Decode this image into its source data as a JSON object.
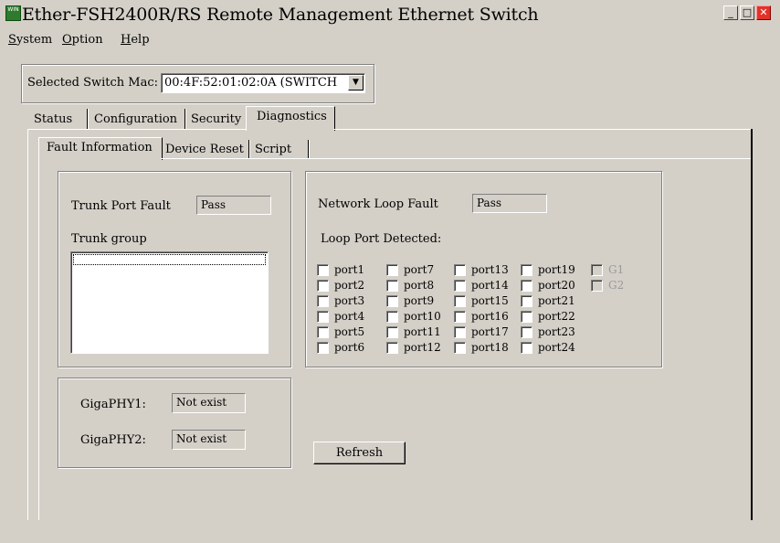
{
  "window": {
    "title": "Ether-FSH2400R/RS Remote Management Ethernet Switch",
    "icon_text": "WIN",
    "minimize": "_",
    "maximize": "□",
    "close": "✕"
  },
  "menu": {
    "items": [
      {
        "label": "System",
        "mnemonic": "S",
        "rest": "ystem"
      },
      {
        "label": "Option",
        "mnemonic": "O",
        "rest": "ption"
      },
      {
        "label": "Help",
        "mnemonic": "H",
        "rest": "elp"
      }
    ]
  },
  "selector": {
    "label": "Selected Switch Mac:",
    "value": "00:4F:52:01:02:0A (SWITCH",
    "arrow": "▼"
  },
  "main_tabs": [
    "Status",
    "Configuration",
    "Security",
    "Diagnostics"
  ],
  "main_tab_active": "Diagnostics",
  "sub_tabs": [
    "Fault Information",
    "Device Reset",
    "Script"
  ],
  "sub_tab_active": "Fault Information",
  "trunk": {
    "fault_label": "Trunk Port Fault",
    "fault_value": "Pass",
    "group_label": "Trunk group"
  },
  "loop": {
    "fault_label": "Network Loop Fault",
    "fault_value": "Pass",
    "detected_label": "Loop Port Detected:",
    "columns": [
      [
        "port1",
        "port2",
        "port3",
        "port4",
        "port5",
        "port6"
      ],
      [
        "port7",
        "port8",
        "port9",
        "port10",
        "port11",
        "port12"
      ],
      [
        "port13",
        "port14",
        "port15",
        "port16",
        "port17",
        "port18"
      ],
      [
        "port19",
        "port20",
        "port21",
        "port22",
        "port23",
        "port24"
      ],
      [
        "G1",
        "G2"
      ]
    ],
    "disabled": [
      "G1",
      "G2"
    ]
  },
  "giga": {
    "phy1_label": "GigaPHY1:",
    "phy1_value": "Not exist",
    "phy2_label": "GigaPHY2:",
    "phy2_value": "Not exist"
  },
  "refresh_label": "Refresh"
}
